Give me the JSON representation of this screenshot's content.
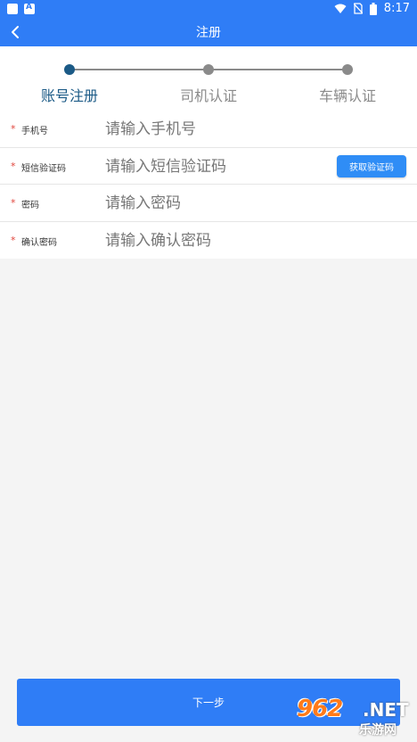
{
  "status_bar": {
    "time": "8:17"
  },
  "header": {
    "title": "注册"
  },
  "steps": [
    {
      "label": "账号注册",
      "active": true
    },
    {
      "label": "司机认证",
      "active": false
    },
    {
      "label": "车辆认证",
      "active": false
    }
  ],
  "form": {
    "required_mark": "*",
    "phone": {
      "label": "手机号",
      "placeholder": "请输入手机号",
      "value": ""
    },
    "sms_code": {
      "label": "短信验证码",
      "placeholder": "请输入短信验证码",
      "value": "",
      "button": "获取验证码"
    },
    "password": {
      "label": "密码",
      "placeholder": "请输入密码",
      "value": ""
    },
    "confirm_password": {
      "label": "确认密码",
      "placeholder": "请输入确认密码",
      "value": ""
    }
  },
  "footer": {
    "next_label": "下一步"
  },
  "watermark": {
    "logo": "962",
    "suffix": ".NET",
    "text": "乐游网"
  },
  "colors": {
    "primary": "#2f7df6",
    "active_step": "#1b5a86",
    "inactive": "#8a8a8a",
    "required": "#e0443b"
  }
}
